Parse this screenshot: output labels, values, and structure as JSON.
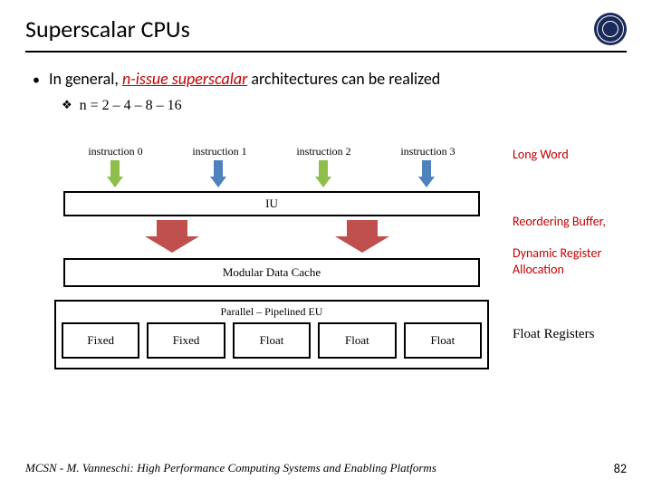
{
  "title": "Superscalar CPUs",
  "intro": {
    "prefix": "In general, ",
    "em": "n-issue superscalar",
    "suffix": " architectures can be realized"
  },
  "sub": "n = 2 – 4 – 8 – 16",
  "instructions": [
    "instruction 0",
    "instruction 1",
    "instruction 2",
    "instruction 3"
  ],
  "iu": "IU",
  "mdc": "Modular Data Cache",
  "peu": "Parallel – Pipelined EU",
  "eu": [
    "Fixed",
    "Fixed",
    "Float",
    "Float",
    "Float"
  ],
  "side": {
    "long": "Long Word",
    "reorder": "Reordering Buffer,",
    "dynamic": "Dynamic Register Allocation",
    "regs": "Float Registers"
  },
  "footer": {
    "left": "MCSN  -   M. Vanneschi: High Performance Computing Systems and Enabling Platforms",
    "page": "82"
  }
}
